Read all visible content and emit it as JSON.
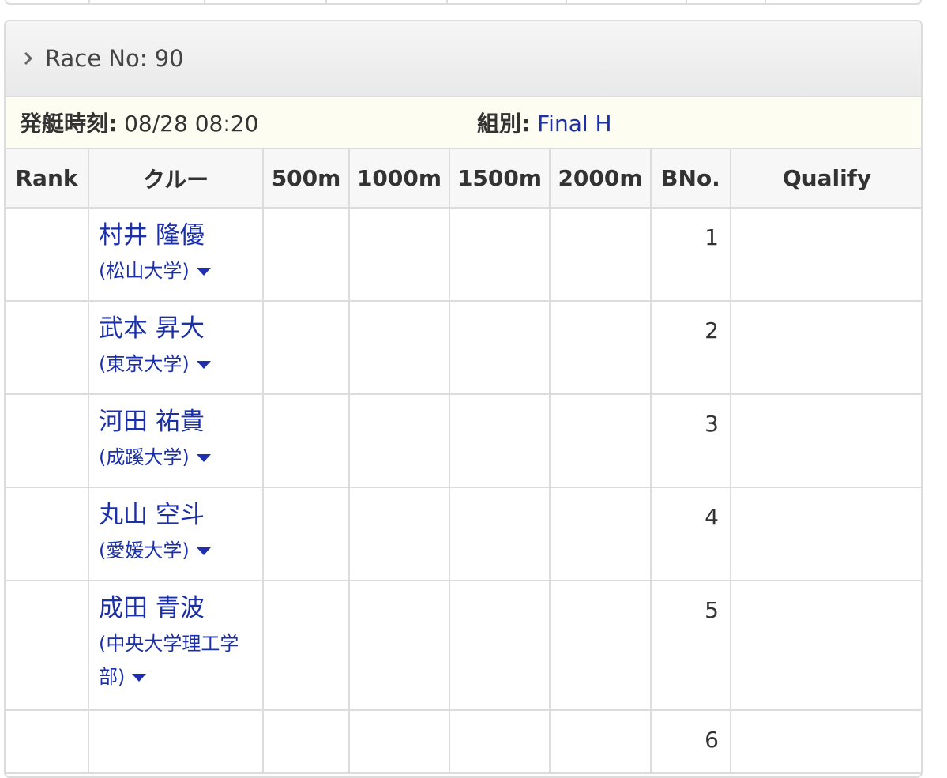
{
  "race": {
    "title": "Race No: 90",
    "start_label": "発艇時刻:",
    "start_time": "08/28 08:20",
    "group_label": "組別:",
    "group": "Final H"
  },
  "table": {
    "headers": [
      "Rank",
      "クルー",
      "500m",
      "1000m",
      "1500m",
      "2000m",
      "BNo.",
      "Qualify"
    ],
    "rows": [
      {
        "rank": "",
        "name": "村井 隆優",
        "team": "(松山大学)",
        "t500": "",
        "t1000": "",
        "t1500": "",
        "t2000": "",
        "bno": "1",
        "qualify": ""
      },
      {
        "rank": "",
        "name": "武本 昇大",
        "team": "(東京大学)",
        "t500": "",
        "t1000": "",
        "t1500": "",
        "t2000": "",
        "bno": "2",
        "qualify": ""
      },
      {
        "rank": "",
        "name": "河田 祐貴",
        "team": "(成蹊大学)",
        "t500": "",
        "t1000": "",
        "t1500": "",
        "t2000": "",
        "bno": "3",
        "qualify": ""
      },
      {
        "rank": "",
        "name": "丸山 空斗",
        "team": "(愛媛大学)",
        "t500": "",
        "t1000": "",
        "t1500": "",
        "t2000": "",
        "bno": "4",
        "qualify": ""
      },
      {
        "rank": "",
        "name": "成田 青波",
        "team": "(中央大学理工学部)",
        "t500": "",
        "t1000": "",
        "t1500": "",
        "t2000": "",
        "bno": "5",
        "qualify": ""
      },
      {
        "rank": "",
        "name": "",
        "team": "",
        "t500": "",
        "t1000": "",
        "t1500": "",
        "t2000": "",
        "bno": "6",
        "qualify": ""
      }
    ]
  },
  "colors": {
    "link": "#1a2fa8",
    "border": "#dcdcdc",
    "info_bg": "#fdfdf1"
  },
  "icons": {
    "race_toggle": "chevron-right-icon",
    "team_toggle": "caret-down-icon"
  }
}
